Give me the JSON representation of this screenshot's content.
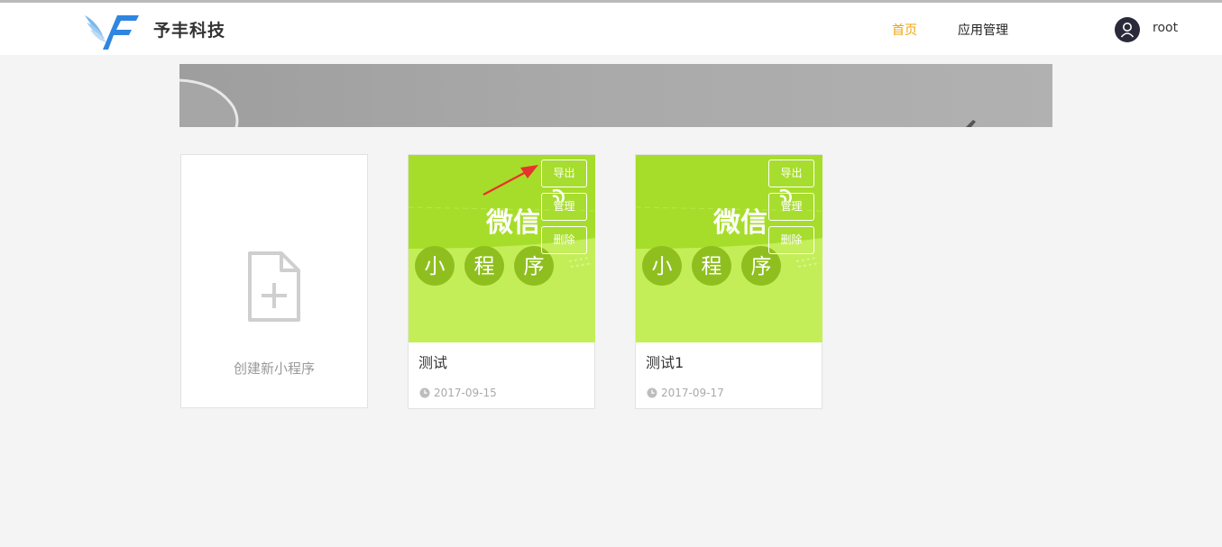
{
  "header": {
    "brand": "予丰科技",
    "nav": {
      "home": "首页",
      "apps": "应用管理"
    },
    "username": "root"
  },
  "create": {
    "label": "创建新小程序"
  },
  "thumb_text": {
    "wechat": "微信",
    "c1": "小",
    "c2": "程",
    "c3": "序"
  },
  "apps": [
    {
      "name": "测试",
      "date": "2017-09-15",
      "export_label": "导出",
      "manage_label": "管理",
      "delete_label": "删除"
    },
    {
      "name": "测试1",
      "date": "2017-09-17",
      "export_label": "导出",
      "manage_label": "管理",
      "delete_label": "删除"
    }
  ],
  "colors": {
    "accent": "#f0a30a",
    "thumb_bg": "#a6dd2a",
    "thumb_light": "#c3ee58",
    "circle": "#8fbf1f"
  }
}
